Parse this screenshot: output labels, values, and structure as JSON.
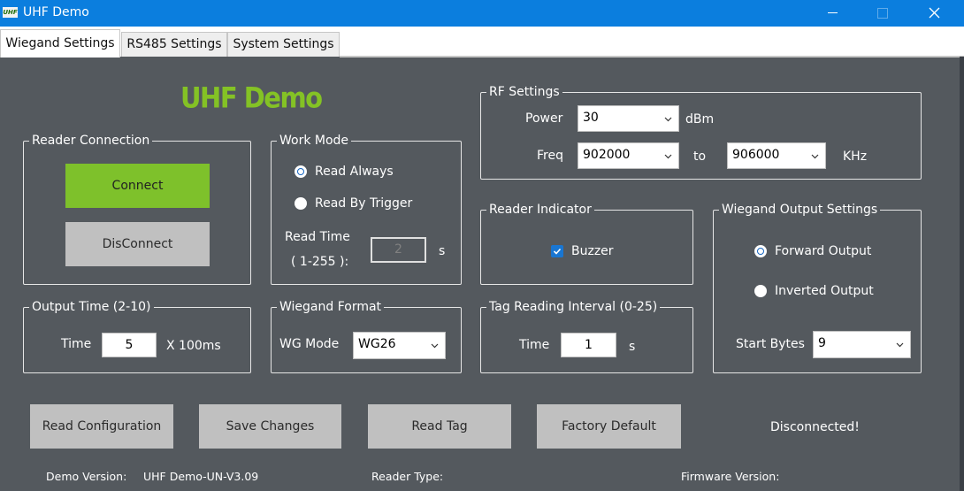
{
  "window": {
    "title": "UHF Demo",
    "logo_text": "UHF"
  },
  "tabs": [
    {
      "label": "Wiegand Settings",
      "active": true
    },
    {
      "label": "RS485 Settings",
      "active": false
    },
    {
      "label": "System Settings",
      "active": false
    }
  ],
  "heading": "UHF Demo",
  "reader_connection": {
    "legend": "Reader Connection",
    "connect_label": "Connect",
    "disconnect_label": "DisConnect"
  },
  "work_mode": {
    "legend": "Work Mode",
    "options": [
      {
        "label": "Read Always",
        "selected": true
      },
      {
        "label": "Read By Trigger",
        "selected": false
      }
    ],
    "read_time_label": "Read Time",
    "read_time_range": "( 1-255 ):",
    "read_time_value": "2",
    "read_time_unit": "s"
  },
  "rf_settings": {
    "legend": "RF Settings",
    "power_label": "Power",
    "power_value": "30",
    "power_unit": "dBm",
    "freq_label": "Freq",
    "freq_from": "902000",
    "freq_to_label": "to",
    "freq_to": "906000",
    "freq_unit": "KHz"
  },
  "reader_indicator": {
    "legend": "Reader Indicator",
    "buzzer_label": "Buzzer",
    "buzzer_checked": true
  },
  "wiegand_output": {
    "legend": "Wiegand Output Settings",
    "options": [
      {
        "label": "Forward Output",
        "selected": true
      },
      {
        "label": "Inverted Output",
        "selected": false
      }
    ],
    "start_bytes_label": "Start Bytes",
    "start_bytes_value": "9"
  },
  "output_time": {
    "legend": "Output Time (2-10)",
    "label": "Time",
    "value": "5",
    "unit": "X 100ms"
  },
  "wiegand_format": {
    "legend": "Wiegand Format",
    "label": "WG Mode",
    "value": "WG26"
  },
  "tag_interval": {
    "legend": "Tag Reading Interval (0-25)",
    "label": "Time",
    "value": "1",
    "unit": "s"
  },
  "actions": {
    "read_config": "Read Configuration",
    "save_changes": "Save Changes",
    "read_tag": "Read Tag",
    "factory_default": "Factory Default"
  },
  "status": "Disconnected!",
  "footer": {
    "demo_version_label": "Demo Version:",
    "demo_version_value": "UHF Demo-UN-V3.09",
    "reader_type_label": "Reader Type:",
    "firmware_version_label": "Firmware Version:"
  },
  "colors": {
    "titlebar": "#0b7ede",
    "background": "#54595e",
    "accent_green": "#7ec12b",
    "heading_green": "#84c225"
  }
}
